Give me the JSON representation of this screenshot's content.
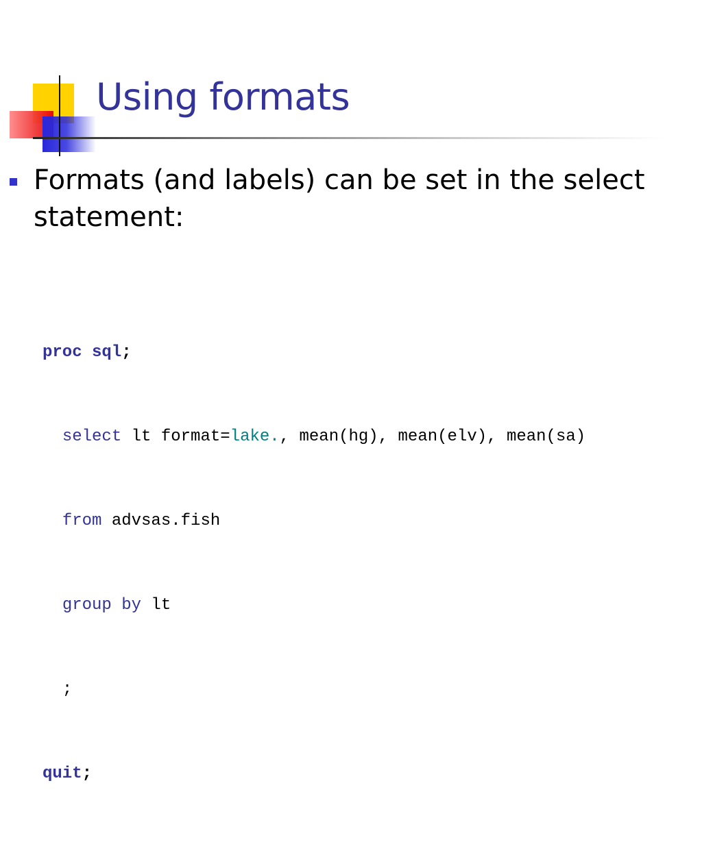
{
  "slide": {
    "title": "Using formats",
    "bullet_text": "Formats (and labels) can be set in the select statement:",
    "code": {
      "line1": {
        "kw": "proc sql",
        "punct": ";"
      },
      "line2": {
        "indent": "  ",
        "kw": "select",
        "t1": " lt format=",
        "fmt": "lake.",
        "t2": ", mean(hg), mean(elv), mean(sa)"
      },
      "line3": {
        "indent": "  ",
        "kw": "from",
        "t1": " advsas.fish"
      },
      "line4": {
        "indent": "  ",
        "kw": "group by",
        "t1": " lt"
      },
      "line5": {
        "indent": "  ",
        "t1": ";"
      },
      "line6": {
        "kw": "quit",
        "punct": ";"
      }
    }
  },
  "colors": {
    "title": "#333399",
    "bullet": "#3333cc",
    "keyword": "#333399",
    "format": "#008080",
    "deco_yellow": "#ffd200",
    "deco_red": "#e60000",
    "deco_blue": "#2828dc"
  }
}
